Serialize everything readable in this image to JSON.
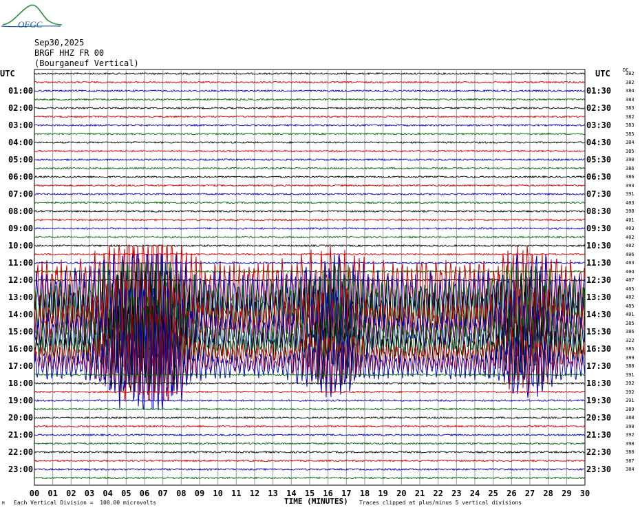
{
  "header": {
    "logo_text": "OFGC",
    "date": "Sep30,2025",
    "station": "BRGF HHZ FR 00",
    "location": "(Bourganeuf Vertical)"
  },
  "left_axis_title": "UTC",
  "right_axis_title": "UTC",
  "dc_label": "DC",
  "footer": {
    "division": "Each Vertical Division =  100.00 microvolts",
    "xlabel": "TIME (MINUTES)",
    "clip_note": "Traces clipped at plus/minus 5 vertical divisions",
    "mark": "M"
  },
  "chart_data": {
    "type": "line",
    "title": "Sep30,2025",
    "xlabel": "TIME (MINUTES)",
    "x_ticks": [
      "00",
      "01",
      "02",
      "03",
      "04",
      "05",
      "06",
      "07",
      "08",
      "09",
      "10",
      "11",
      "12",
      "13",
      "14",
      "15",
      "16",
      "17",
      "18",
      "19",
      "20",
      "21",
      "22",
      "23",
      "24",
      "25",
      "26",
      "27",
      "28",
      "29",
      "30"
    ],
    "left_labels": [
      "01:00",
      "02:00",
      "03:00",
      "04:00",
      "05:00",
      "06:00",
      "07:00",
      "08:00",
      "09:00",
      "10:00",
      "11:00",
      "12:00",
      "13:00",
      "14:00",
      "15:00",
      "16:00",
      "17:00",
      "18:00",
      "19:00",
      "20:00",
      "21:00",
      "22:00",
      "23:00"
    ],
    "right_labels": [
      "01:30",
      "02:30",
      "03:30",
      "04:30",
      "05:30",
      "06:30",
      "07:30",
      "08:30",
      "09:30",
      "10:30",
      "11:30",
      "12:30",
      "13:30",
      "14:30",
      "15:30",
      "16:30",
      "17:30",
      "18:30",
      "19:30",
      "20:30",
      "21:30",
      "22:30",
      "23:30"
    ],
    "dc_offsets": [
      382,
      382,
      384,
      383,
      383,
      382,
      383,
      385,
      384,
      385,
      390,
      386,
      386,
      393,
      391,
      403,
      398,
      401,
      403,
      402,
      402,
      406,
      403,
      404,
      407,
      405,
      402,
      405,
      401,
      385,
      386,
      322,
      385,
      399,
      388,
      391,
      392,
      392,
      391,
      389,
      388,
      390,
      392,
      390,
      388,
      387,
      384
    ],
    "trace_colors": [
      "#000000",
      "#d40000",
      "#0000c8",
      "#006400"
    ],
    "grid": true,
    "x_range": [
      0,
      30
    ],
    "trace_count": 48,
    "event": {
      "start_trace": 25,
      "end_trace": 34,
      "onset_minute": 0,
      "peak_minutes": [
        4.8,
        6.1,
        7.0,
        16.2,
        26.8
      ],
      "max_division": 5
    }
  }
}
